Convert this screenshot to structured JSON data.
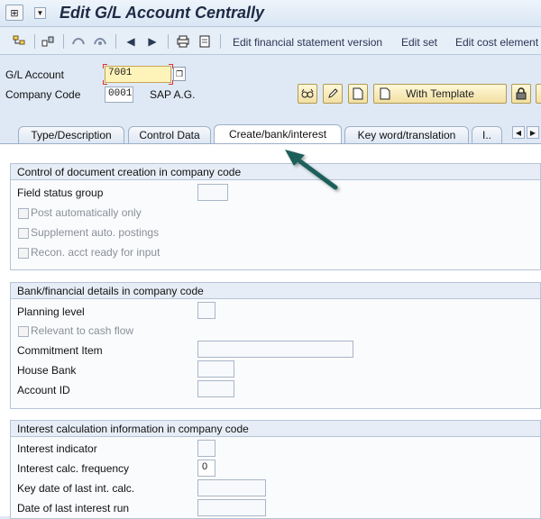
{
  "window": {
    "title": "Edit G/L Account Centrally"
  },
  "toolbar": {
    "links": [
      "Edit financial statement version",
      "Edit set",
      "Edit cost element"
    ]
  },
  "header": {
    "gl_account_label": "G/L Account",
    "gl_account_value": "7001",
    "company_code_label": "Company Code",
    "company_code_value": "0001",
    "company_name": "SAP A.G.",
    "with_template_label": "With Template"
  },
  "tabs": [
    {
      "label": "Type/Description"
    },
    {
      "label": "Control Data"
    },
    {
      "label": "Create/bank/interest"
    },
    {
      "label": "Key word/translation"
    },
    {
      "label": "I.."
    }
  ],
  "groups": {
    "control": {
      "title": "Control of document creation in company code",
      "field_status_group_label": "Field status group",
      "post_auto_label": "Post automatically only",
      "supplement_label": "Supplement auto. postings",
      "recon_label": "Recon. acct ready for input"
    },
    "bank": {
      "title": "Bank/financial details in company code",
      "planning_level_label": "Planning level",
      "relevant_cash_flow_label": "Relevant to cash flow",
      "commitment_item_label": "Commitment Item",
      "house_bank_label": "House Bank",
      "account_id_label": "Account ID"
    },
    "interest": {
      "title": "Interest calculation information in company code",
      "indicator_label": "Interest indicator",
      "frequency_label": "Interest calc. frequency",
      "frequency_value": "0",
      "key_date_label": "Key date of last int. calc.",
      "last_run_label": "Date of last interest run"
    }
  },
  "colors": {
    "accent_arrow": "#1f5f5a",
    "active_field": "#fef3b8"
  }
}
